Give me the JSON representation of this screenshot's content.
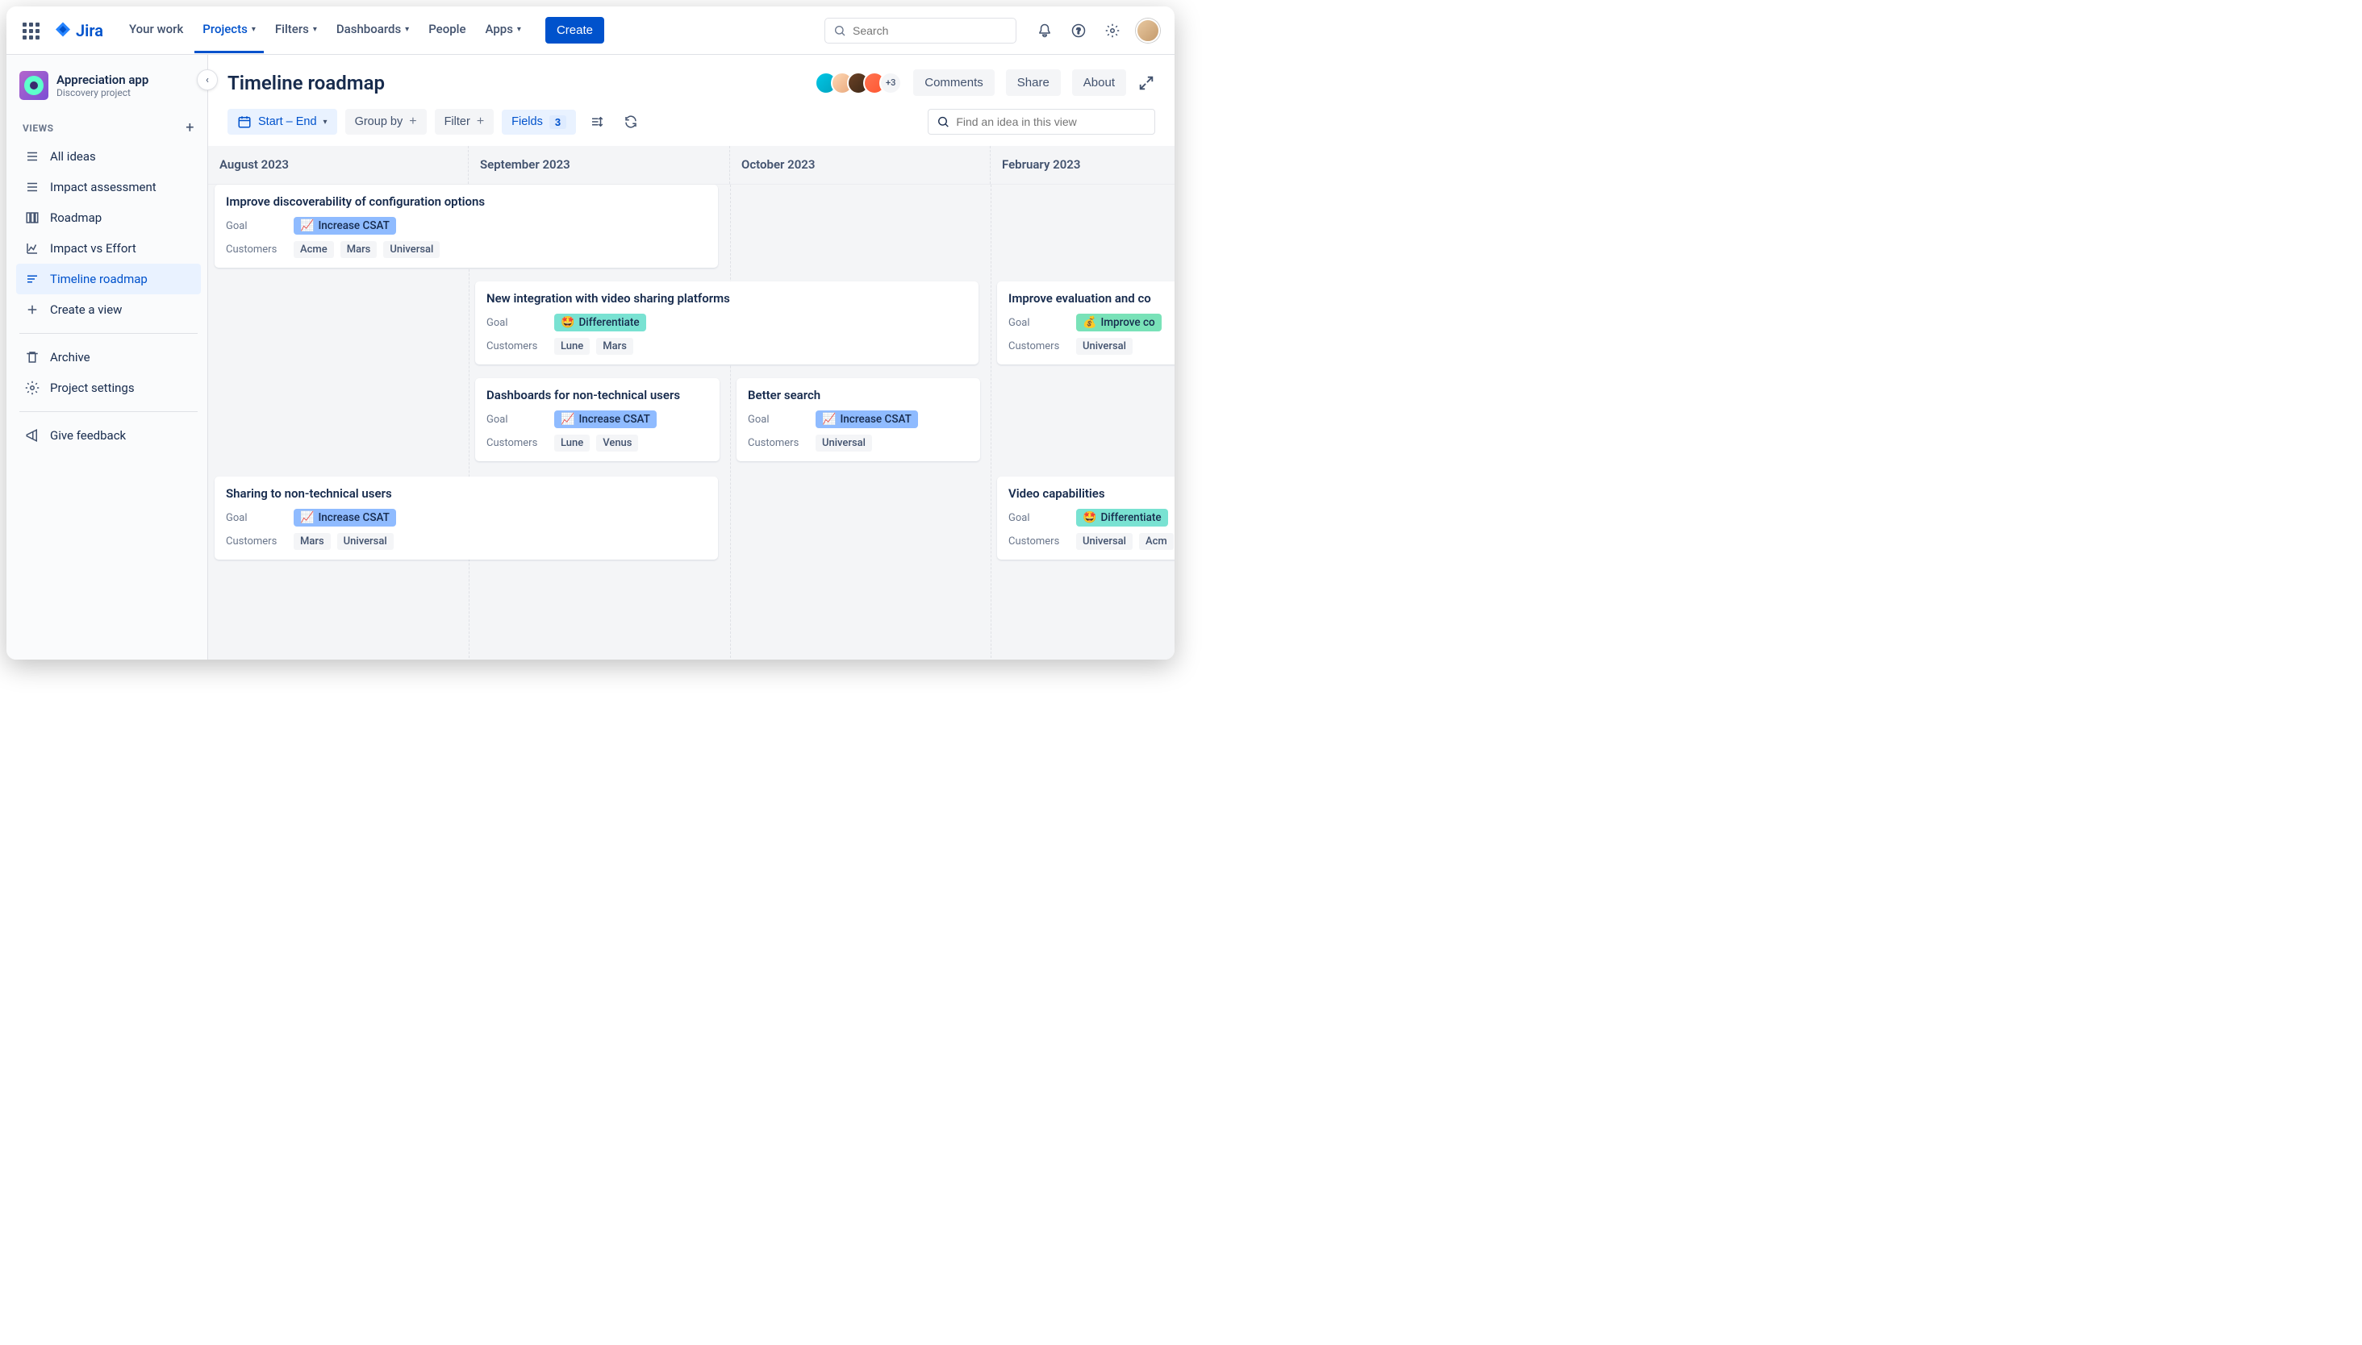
{
  "nav": {
    "product": "Jira",
    "items": [
      "Your work",
      "Projects",
      "Filters",
      "Dashboards",
      "People",
      "Apps"
    ],
    "create": "Create",
    "search_placeholder": "Search"
  },
  "project": {
    "name": "Appreciation app",
    "subtitle": "Discovery project"
  },
  "sidebar": {
    "section": "VIEWS",
    "items": [
      "All ideas",
      "Impact assessment",
      "Roadmap",
      "Impact vs Effort",
      "Timeline roadmap",
      "Create a view"
    ],
    "archive": "Archive",
    "settings": "Project settings",
    "feedback": "Give feedback"
  },
  "header": {
    "title": "Timeline roadmap",
    "avatar_overflow": "+3",
    "comments": "Comments",
    "share": "Share",
    "about": "About"
  },
  "toolbar": {
    "date": "Start – End",
    "groupby": "Group by",
    "filter": "Filter",
    "fields": "Fields",
    "fields_count": "3",
    "find_placeholder": "Find an idea in this view"
  },
  "timeline": {
    "months": [
      "August 2023",
      "September 2023",
      "October 2023",
      "February 2023"
    ],
    "labels": {
      "goal": "Goal",
      "customers": "Customers"
    },
    "goals": {
      "csat": "Increase CSAT",
      "diff": "Differentiate",
      "conv": "Improve co"
    },
    "cards": [
      {
        "title": "Improve discoverability of configuration options",
        "goal": "csat",
        "customers": [
          "Acme",
          "Mars",
          "Universal"
        ]
      },
      {
        "title": "New integration with video sharing platforms",
        "goal": "diff",
        "customers": [
          "Lune",
          "Mars"
        ]
      },
      {
        "title": "Improve evaluation and co",
        "goal": "conv",
        "customers": [
          "Universal"
        ]
      },
      {
        "title": "Dashboards for non-technical users",
        "goal": "csat",
        "customers": [
          "Lune",
          "Venus"
        ]
      },
      {
        "title": "Better search",
        "goal": "csat",
        "customers": [
          "Universal"
        ]
      },
      {
        "title": "Sharing to non-technical users",
        "goal": "csat",
        "customers": [
          "Mars",
          "Universal"
        ]
      },
      {
        "title": "Video capabilities",
        "goal": "diff",
        "customers": [
          "Universal",
          "Acm"
        ]
      }
    ]
  }
}
